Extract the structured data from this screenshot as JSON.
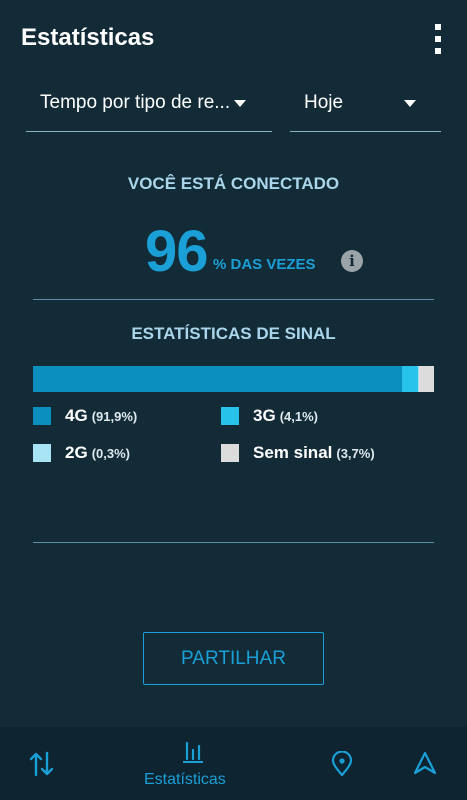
{
  "appbar": {
    "title": "Estatísticas",
    "menu_icon": "more-vert-icon"
  },
  "filters": {
    "type_value": "Tempo por tipo de re...",
    "period_value": "Hoje"
  },
  "connection": {
    "label": "VOCÊ ESTÁ CONECTADO",
    "percent": "96",
    "suffix": "% DAS VEZES",
    "info_icon": "info-icon"
  },
  "signal": {
    "title": "ESTATÍSTICAS DE SINAL",
    "segments": [
      {
        "name": "4G",
        "percent_label": "(91,9%)",
        "value": 91.9,
        "color": "#0a8fbf"
      },
      {
        "name": "3G",
        "percent_label": "(4,1%)",
        "value": 4.1,
        "color": "#27c3ea"
      },
      {
        "name": "2G",
        "percent_label": "(0,3%)",
        "value": 0.3,
        "color": "#a8e4f5"
      },
      {
        "name": "Sem sinal",
        "percent_label": "(3,7%)",
        "value": 3.7,
        "color": "#dcdcdc"
      }
    ]
  },
  "actions": {
    "share_label": "PARTILHAR"
  },
  "bottom_nav": {
    "items": [
      {
        "icon": "data-transfer-icon",
        "label": ""
      },
      {
        "icon": "bar-chart-icon",
        "label": "Estatísticas"
      },
      {
        "icon": "location-pin-icon",
        "label": ""
      },
      {
        "icon": "navigation-arrow-icon",
        "label": ""
      }
    ]
  },
  "colors": {
    "background": "#122b37",
    "accent": "#1a9fd6",
    "nav_background": "#0e2430"
  }
}
